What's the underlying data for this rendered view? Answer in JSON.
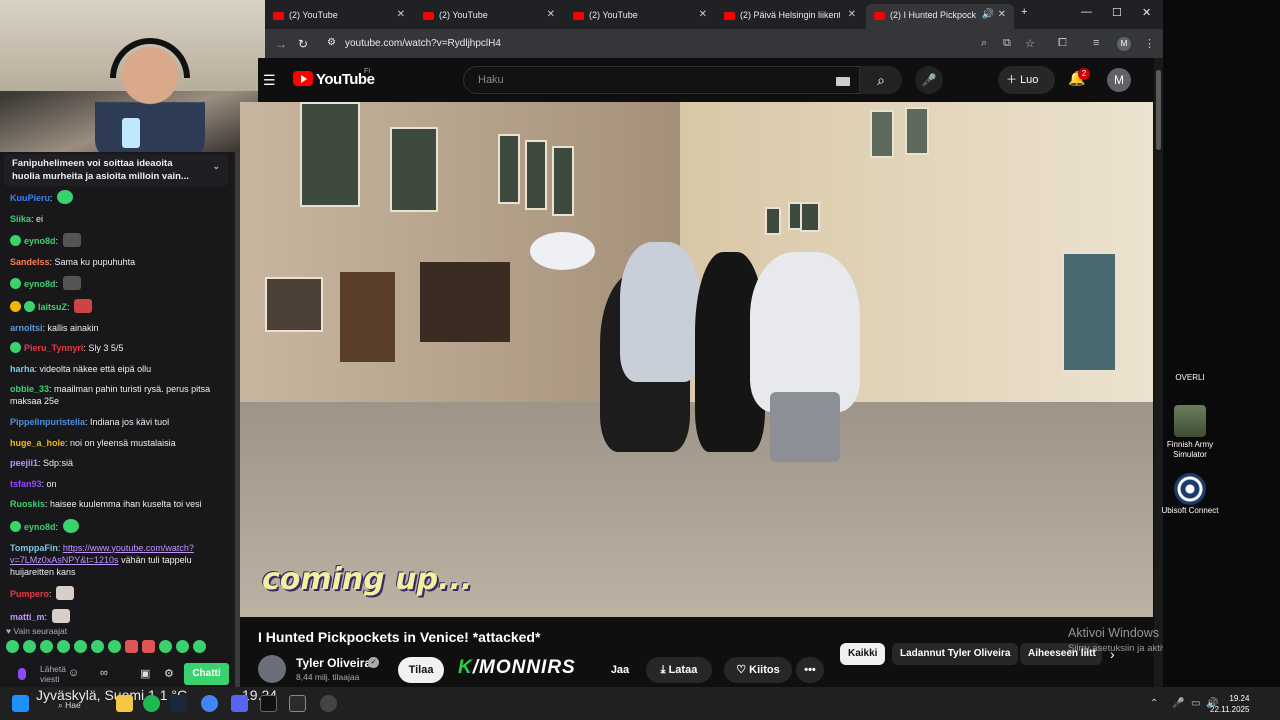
{
  "browser": {
    "tabs": [
      {
        "label": "(2) YouTube"
      },
      {
        "label": "(2) YouTube"
      },
      {
        "label": "(2) YouTube"
      },
      {
        "label": "(2) Päivä Helsingin liikentees"
      },
      {
        "label": "(2) I Hunted Pickpockets"
      }
    ],
    "url": "youtube.com/watch?v=RydljhpclH4"
  },
  "youtube": {
    "logo_text": "YouTube",
    "region": "FI",
    "search_placeholder": "Haku",
    "create_label": "Luo",
    "notifications_count": "2",
    "avatar_letter": "M",
    "video_caption": "coming up...",
    "video_title": "I Hunted Pickpockets in Venice! *attacked*",
    "channel_name": "Tyler Oliveira",
    "subscribers": "8,44 milj. tilaajaa",
    "subscribe_label": "Tilaa",
    "share_label": "Jaa",
    "download_label": "Lataa",
    "thanks_label": "Kiitos",
    "more_label": "•••",
    "chips": [
      "Kaikki",
      "Ladannut Tyler Oliveira",
      "Aiheeseen liitt"
    ]
  },
  "stream_overlay": {
    "logo_text": "/MONNIRS",
    "logo_k": "K"
  },
  "chat": {
    "pinned": "Fanipuhelimeen voi soittaa ideaoita huolia murheita ja asioita milloin vain...",
    "messages": [
      {
        "user": "KuuPieru",
        "color": "#3b82f6",
        "text": ""
      },
      {
        "user": "Siika",
        "color": "#3bd16f",
        "text": "ei"
      },
      {
        "user": "eyno8d",
        "color": "#3bd16f",
        "text": ""
      },
      {
        "user": "Sandelss",
        "color": "#ff7f50",
        "text": "Sama ku pupuhuhta"
      },
      {
        "user": "eyno8d",
        "color": "#3bd16f",
        "text": ""
      },
      {
        "user": "laitsuZ",
        "color": "#3bd16f",
        "text": ""
      },
      {
        "user": "arnoltsi",
        "color": "#5b9bd5",
        "text": "kallis ainakin"
      },
      {
        "user": "Pieru_Tynnyri",
        "color": "#e63946",
        "text": "Sly 3 5/5"
      },
      {
        "user": "harha",
        "color": "#7ec8e3",
        "text": "videolta näkee että eipä ollu"
      },
      {
        "user": "obbie_33",
        "color": "#3bd16f",
        "text": "maailman pahin turisti rysä. perus pitsa maksaa 25e"
      },
      {
        "user": "Pippelinpuristelia",
        "color": "#4a90e2",
        "text": "Indiana jos kävi tuol"
      },
      {
        "user": "huge_a_hole",
        "color": "#f2b705",
        "text": "noi on yleensä mustalaisia"
      },
      {
        "user": "peejii1",
        "color": "#bf94ff",
        "text": "Sdp:siä"
      },
      {
        "user": "tsfan93",
        "color": "#9147ff",
        "text": "on"
      },
      {
        "user": "Ruoskis",
        "color": "#3bd16f",
        "text": "haisee kuulemma ihan kuselta toi vesi"
      },
      {
        "user": "eyno8d",
        "color": "#3bd16f",
        "text": ""
      },
      {
        "user": "TomppaFin",
        "color": "#7ec8e3",
        "text": "vähän tuli tappelu huijareitten kans",
        "link": "https://www.youtube.com/watch?v=7LMz0xAsNPY&t=1210s"
      },
      {
        "user": "Pumpero",
        "color": "#e63946",
        "text": ""
      },
      {
        "user": "matti_m",
        "color": "#bf94ff",
        "text": ""
      }
    ],
    "follow_only": "Vain seuraajat",
    "send_placeholder": "Lähetä viesti",
    "chat_button": "Chatti"
  },
  "desktop": {
    "icons": [
      {
        "label": "OVERLI"
      },
      {
        "label": "Finnish Army Simulator"
      },
      {
        "label": "Ubisoft Connect"
      }
    ],
    "activate_title": "Aktivoi Windows",
    "activate_sub": "Siirry asetuksiin ja aktivoi Windows."
  },
  "taskbar": {
    "weather": "Jyväskylä, Suomi   1,1 °C",
    "weather_time": "19.24",
    "search_label": "Hae",
    "time": "19.24",
    "date": "22.11.2025"
  }
}
